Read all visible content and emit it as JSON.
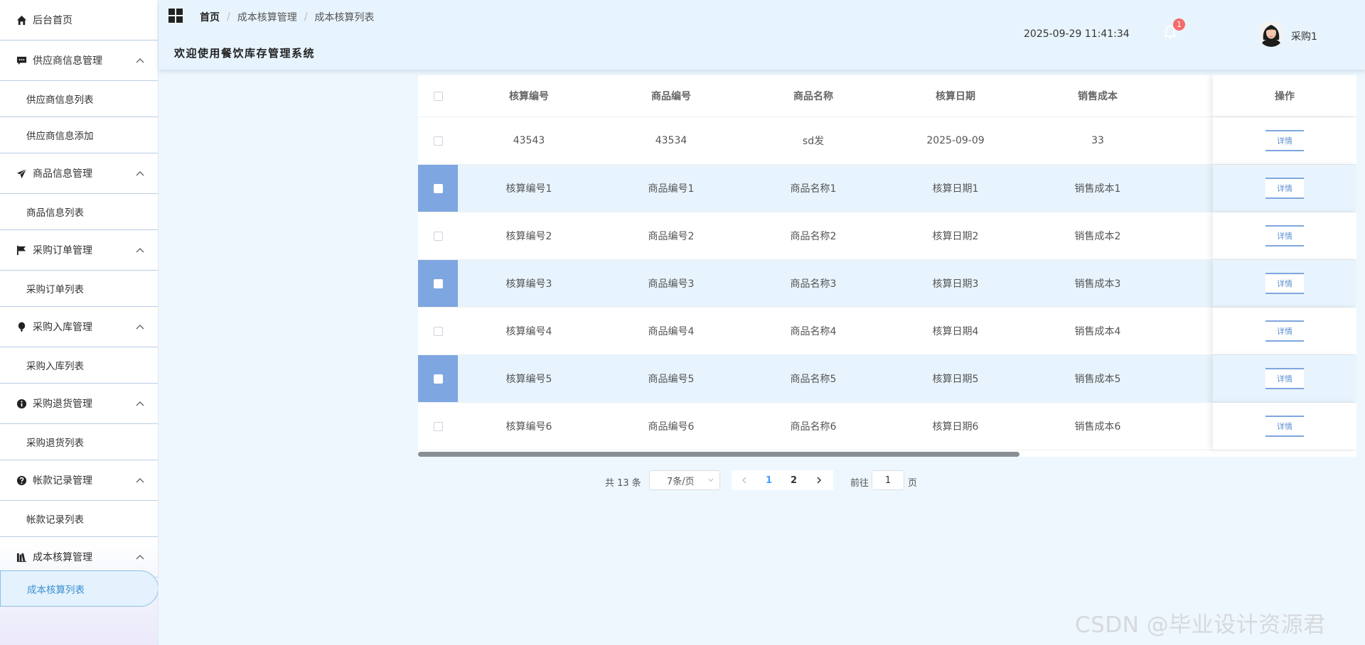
{
  "sidebar": {
    "home": "后台首页",
    "groups": [
      {
        "label": "供应商信息管理",
        "icon": "chat-icon",
        "items": [
          "供应商信息列表",
          "供应商信息添加"
        ]
      },
      {
        "label": "商品信息管理",
        "icon": "send-icon",
        "items": [
          "商品信息列表"
        ]
      },
      {
        "label": "采购订单管理",
        "icon": "flag-icon",
        "items": [
          "采购订单列表"
        ]
      },
      {
        "label": "采购入库管理",
        "icon": "balloon-icon",
        "items": [
          "采购入库列表"
        ]
      },
      {
        "label": "采购退货管理",
        "icon": "info-icon",
        "items": [
          "采购退货列表"
        ]
      },
      {
        "label": "帐款记录管理",
        "icon": "question-icon",
        "items": [
          "帐款记录列表"
        ]
      },
      {
        "label": "成本核算管理",
        "icon": "books-icon",
        "items": [
          "成本核算列表"
        ]
      }
    ],
    "active_item": "成本核算列表"
  },
  "header": {
    "breadcrumb": [
      "首页",
      "成本核算管理",
      "成本核算列表"
    ],
    "welcome": "欢迎使用餐饮库存管理系统",
    "datetime": "2025-09-29 11:41:34",
    "notification_count": "1",
    "username": "采购1"
  },
  "table": {
    "columns": [
      "核算编号",
      "商品编号",
      "商品名称",
      "核算日期",
      "销售成本",
      "操作"
    ],
    "rows": [
      {
        "cells": [
          "43543",
          "43534",
          "sd发",
          "2025-09-09",
          "33"
        ],
        "checked": false
      },
      {
        "cells": [
          "核算编号1",
          "商品编号1",
          "商品名称1",
          "核算日期1",
          "销售成本1"
        ],
        "checked": false
      },
      {
        "cells": [
          "核算编号2",
          "商品编号2",
          "商品名称2",
          "核算日期2",
          "销售成本2"
        ],
        "checked": false
      },
      {
        "cells": [
          "核算编号3",
          "商品编号3",
          "商品名称3",
          "核算日期3",
          "销售成本3"
        ],
        "checked": false
      },
      {
        "cells": [
          "核算编号4",
          "商品编号4",
          "商品名称4",
          "核算日期4",
          "销售成本4"
        ],
        "checked": false
      },
      {
        "cells": [
          "核算编号5",
          "商品编号5",
          "商品名称5",
          "核算日期5",
          "销售成本5"
        ],
        "checked": false
      },
      {
        "cells": [
          "核算编号6",
          "商品编号6",
          "商品名称6",
          "核算日期6",
          "销售成本6"
        ],
        "checked": false
      }
    ],
    "detail_label": "详情"
  },
  "pagination": {
    "total": "共 13 条",
    "page_size": "7条/页",
    "pages": [
      "1",
      "2"
    ],
    "current_page": "1",
    "goto_label": "前往",
    "goto_value": "1",
    "goto_unit": "页"
  },
  "watermark": "CSDN @毕业设计资源君",
  "colors": {
    "accent": "#409eff",
    "stripe": "#e8f4fd",
    "checkbox_stripe": "#7ea6e0",
    "badge": "#f56c6c"
  }
}
